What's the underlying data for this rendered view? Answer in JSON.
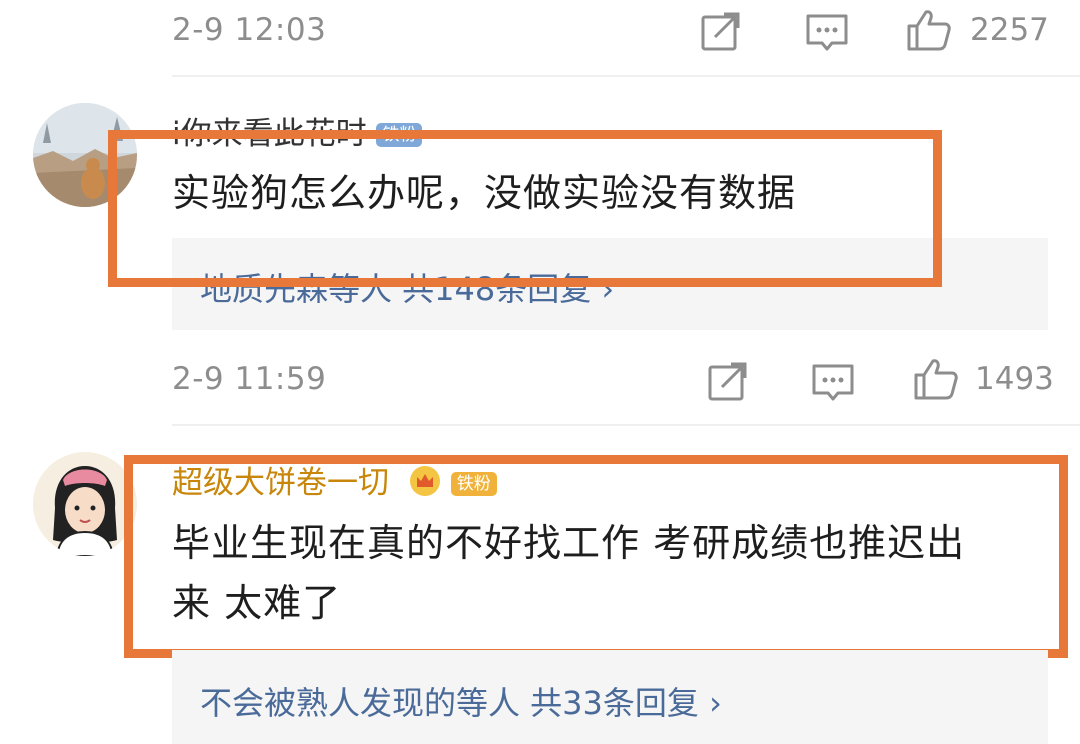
{
  "colors": {
    "highlight": "#e8773a",
    "reply_link": "#4a6a99",
    "username_gold": "#c8860a",
    "meta_gray": "#8d8d8d"
  },
  "top_bar": {
    "date": "2-9 12:03",
    "share_icon": "share-icon",
    "comment_icon": "comment-icon",
    "like_icon": "thumbs-up-icon",
    "like_count": "2257"
  },
  "comment1": {
    "username": "i你来看此花时",
    "badge": "铁粉",
    "text": "实验狗怎么办呢，没做实验没有数据",
    "reply_summary": "地质先森等人 共148条回复 ›",
    "date": "2-9 11:59",
    "like_count": "1493"
  },
  "comment2": {
    "username": "超级大饼卷一切",
    "badge": "铁粉",
    "text_line1": "毕业生现在真的不好找工作 考研成绩也推迟出",
    "text_line2": "来 太难了",
    "reply_summary": "不会被熟人发现的等人 共33条回复 ›"
  }
}
